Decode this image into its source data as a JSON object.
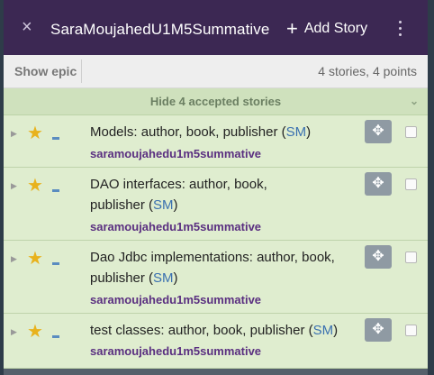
{
  "header": {
    "close_icon": "×",
    "title": "SaraMoujahedU1M5Summative",
    "add_label": "Add Story",
    "add_icon": "+"
  },
  "subbar": {
    "epic_label": "Show epic",
    "count_text": "4 stories, 4 points"
  },
  "accepted": {
    "label": "Hide 4 accepted stories",
    "chevron_icon": "⌄"
  },
  "stories": [
    {
      "title": "Models: author, book, publisher",
      "abbr": "SM",
      "label": "saramoujahedu1m5summative"
    },
    {
      "title": "DAO interfaces: author, book, publisher",
      "abbr": "SM",
      "label": "saramoujahedu1m5summative"
    },
    {
      "title": "Dao Jdbc implementations: author, book, publisher",
      "abbr": "SM",
      "label": "saramoujahedu1m5summative"
    },
    {
      "title": "test classes: author, book, publisher",
      "abbr": "SM",
      "label": "saramoujahedu1m5summative"
    }
  ],
  "icons": {
    "expander": "▶",
    "star": "★",
    "move": "✥"
  },
  "colors": {
    "header_bg": "#3c2853",
    "accepted_bg": "#dfedcf",
    "label_color": "#5a2f80",
    "star_color": "#e8b21d"
  }
}
